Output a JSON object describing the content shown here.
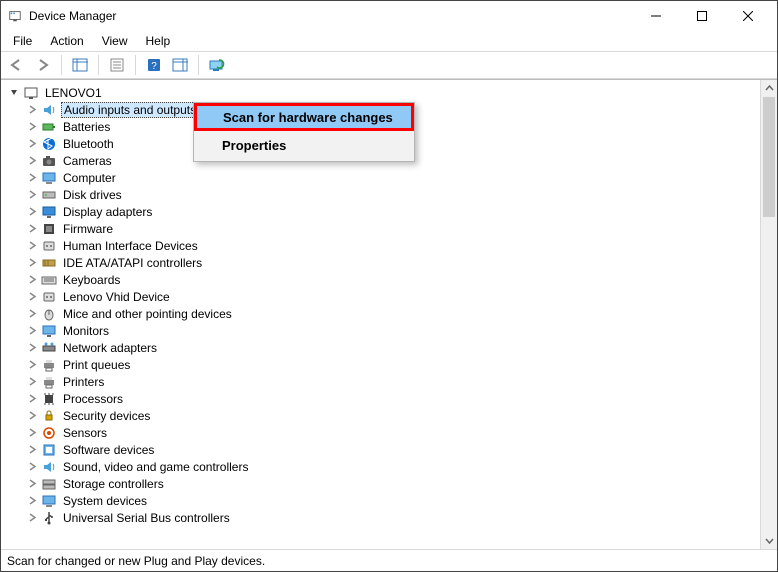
{
  "window": {
    "title": "Device Manager"
  },
  "menubar": {
    "items": [
      "File",
      "Action",
      "View",
      "Help"
    ]
  },
  "toolbar": {
    "back": "Back",
    "forward": "Forward",
    "showhide": "Show/Hide Console Tree",
    "properties": "Properties",
    "help": "Help",
    "actionpane": "Show/Hide Action Pane",
    "scan": "Scan for hardware changes"
  },
  "tree": {
    "root": {
      "label": "LENOVO1",
      "expanded": true
    },
    "children": [
      {
        "label": "Audio inputs and outputs",
        "icon": "audio",
        "selected": true
      },
      {
        "label": "Batteries",
        "icon": "battery"
      },
      {
        "label": "Bluetooth",
        "icon": "bluetooth"
      },
      {
        "label": "Cameras",
        "icon": "camera"
      },
      {
        "label": "Computer",
        "icon": "computer"
      },
      {
        "label": "Disk drives",
        "icon": "disk"
      },
      {
        "label": "Display adapters",
        "icon": "display"
      },
      {
        "label": "Firmware",
        "icon": "firmware"
      },
      {
        "label": "Human Interface Devices",
        "icon": "hid"
      },
      {
        "label": "IDE ATA/ATAPI controllers",
        "icon": "ide"
      },
      {
        "label": "Keyboards",
        "icon": "keyboard"
      },
      {
        "label": "Lenovo Vhid Device",
        "icon": "hid"
      },
      {
        "label": "Mice and other pointing devices",
        "icon": "mouse"
      },
      {
        "label": "Monitors",
        "icon": "monitor"
      },
      {
        "label": "Network adapters",
        "icon": "network"
      },
      {
        "label": "Print queues",
        "icon": "printer"
      },
      {
        "label": "Printers",
        "icon": "printer"
      },
      {
        "label": "Processors",
        "icon": "cpu"
      },
      {
        "label": "Security devices",
        "icon": "security"
      },
      {
        "label": "Sensors",
        "icon": "sensor"
      },
      {
        "label": "Software devices",
        "icon": "software"
      },
      {
        "label": "Sound, video and game controllers",
        "icon": "sound"
      },
      {
        "label": "Storage controllers",
        "icon": "storage"
      },
      {
        "label": "System devices",
        "icon": "system"
      },
      {
        "label": "Universal Serial Bus controllers",
        "icon": "usb"
      }
    ]
  },
  "context_menu": {
    "scan": "Scan for hardware changes",
    "properties": "Properties"
  },
  "statusbar": {
    "text": "Scan for changed or new Plug and Play devices."
  }
}
